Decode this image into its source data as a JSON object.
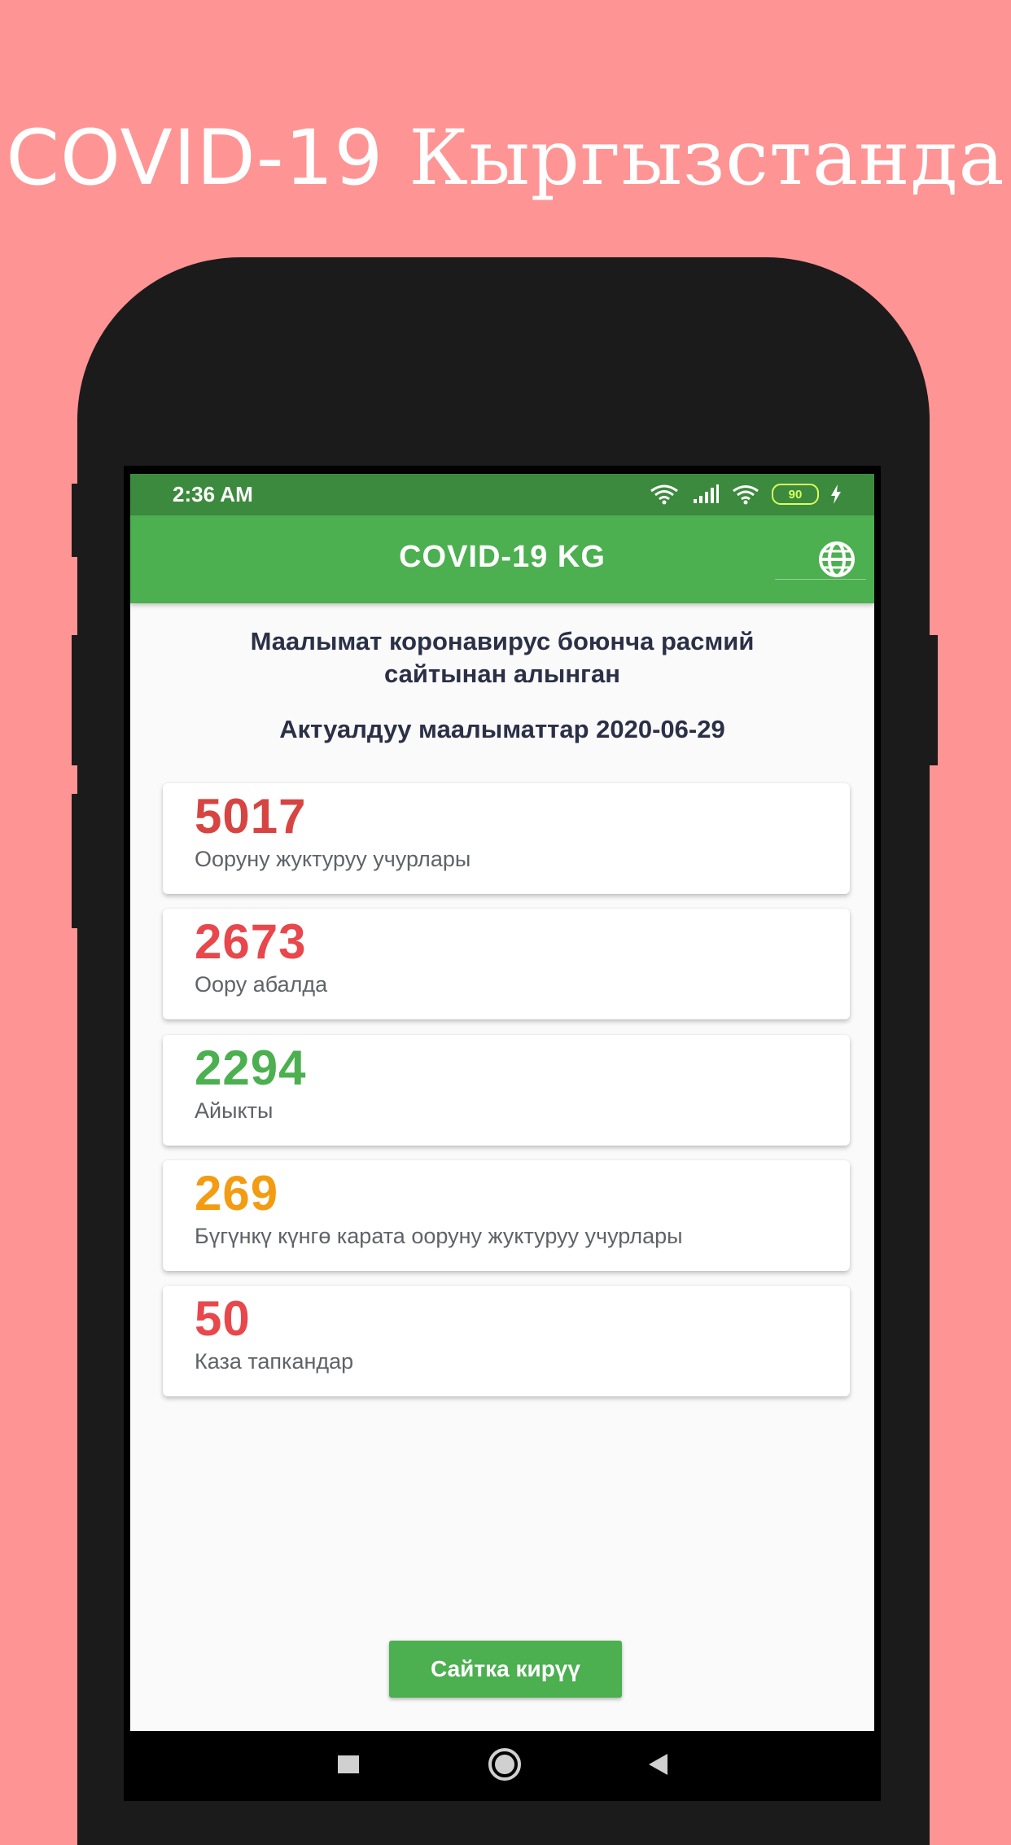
{
  "promo": {
    "title_latin": "COVID-19",
    "title_cyrillic": "Кыргызстанда"
  },
  "status_bar": {
    "time": "2:36 AM",
    "battery": "90"
  },
  "app_bar": {
    "title": "COVID-19 KG",
    "language_icon": "globe-icon"
  },
  "info": {
    "source_line1": "Маалымат коронавирус боюнча расмий",
    "source_line2": "сайтынан алынган",
    "updated": "Актуалдуу маалыматтар 2020-06-29"
  },
  "stats": [
    {
      "value": "5017",
      "label": "Ооруну жуктуруу учурлары",
      "color": "#d64541"
    },
    {
      "value": "2673",
      "label": "Оору абалда",
      "color": "#e8474c"
    },
    {
      "value": "2294",
      "label": "Айыкты",
      "color": "#4caf50"
    },
    {
      "value": "269",
      "label": "Бүгүнкү күнгө карата ооруну жуктуруу учурлары",
      "color": "#f39c12"
    },
    {
      "value": "50",
      "label": "Каза тапкандар",
      "color": "#e8474c"
    }
  ],
  "button": {
    "label": "Сайтка кирүү"
  },
  "colors": {
    "background": "#FF9494",
    "status_bar": "#3c8a3e",
    "app_bar": "#4caf50"
  },
  "nav": {
    "recents": "square-icon",
    "home": "circle-icon",
    "back": "triangle-back-icon"
  }
}
